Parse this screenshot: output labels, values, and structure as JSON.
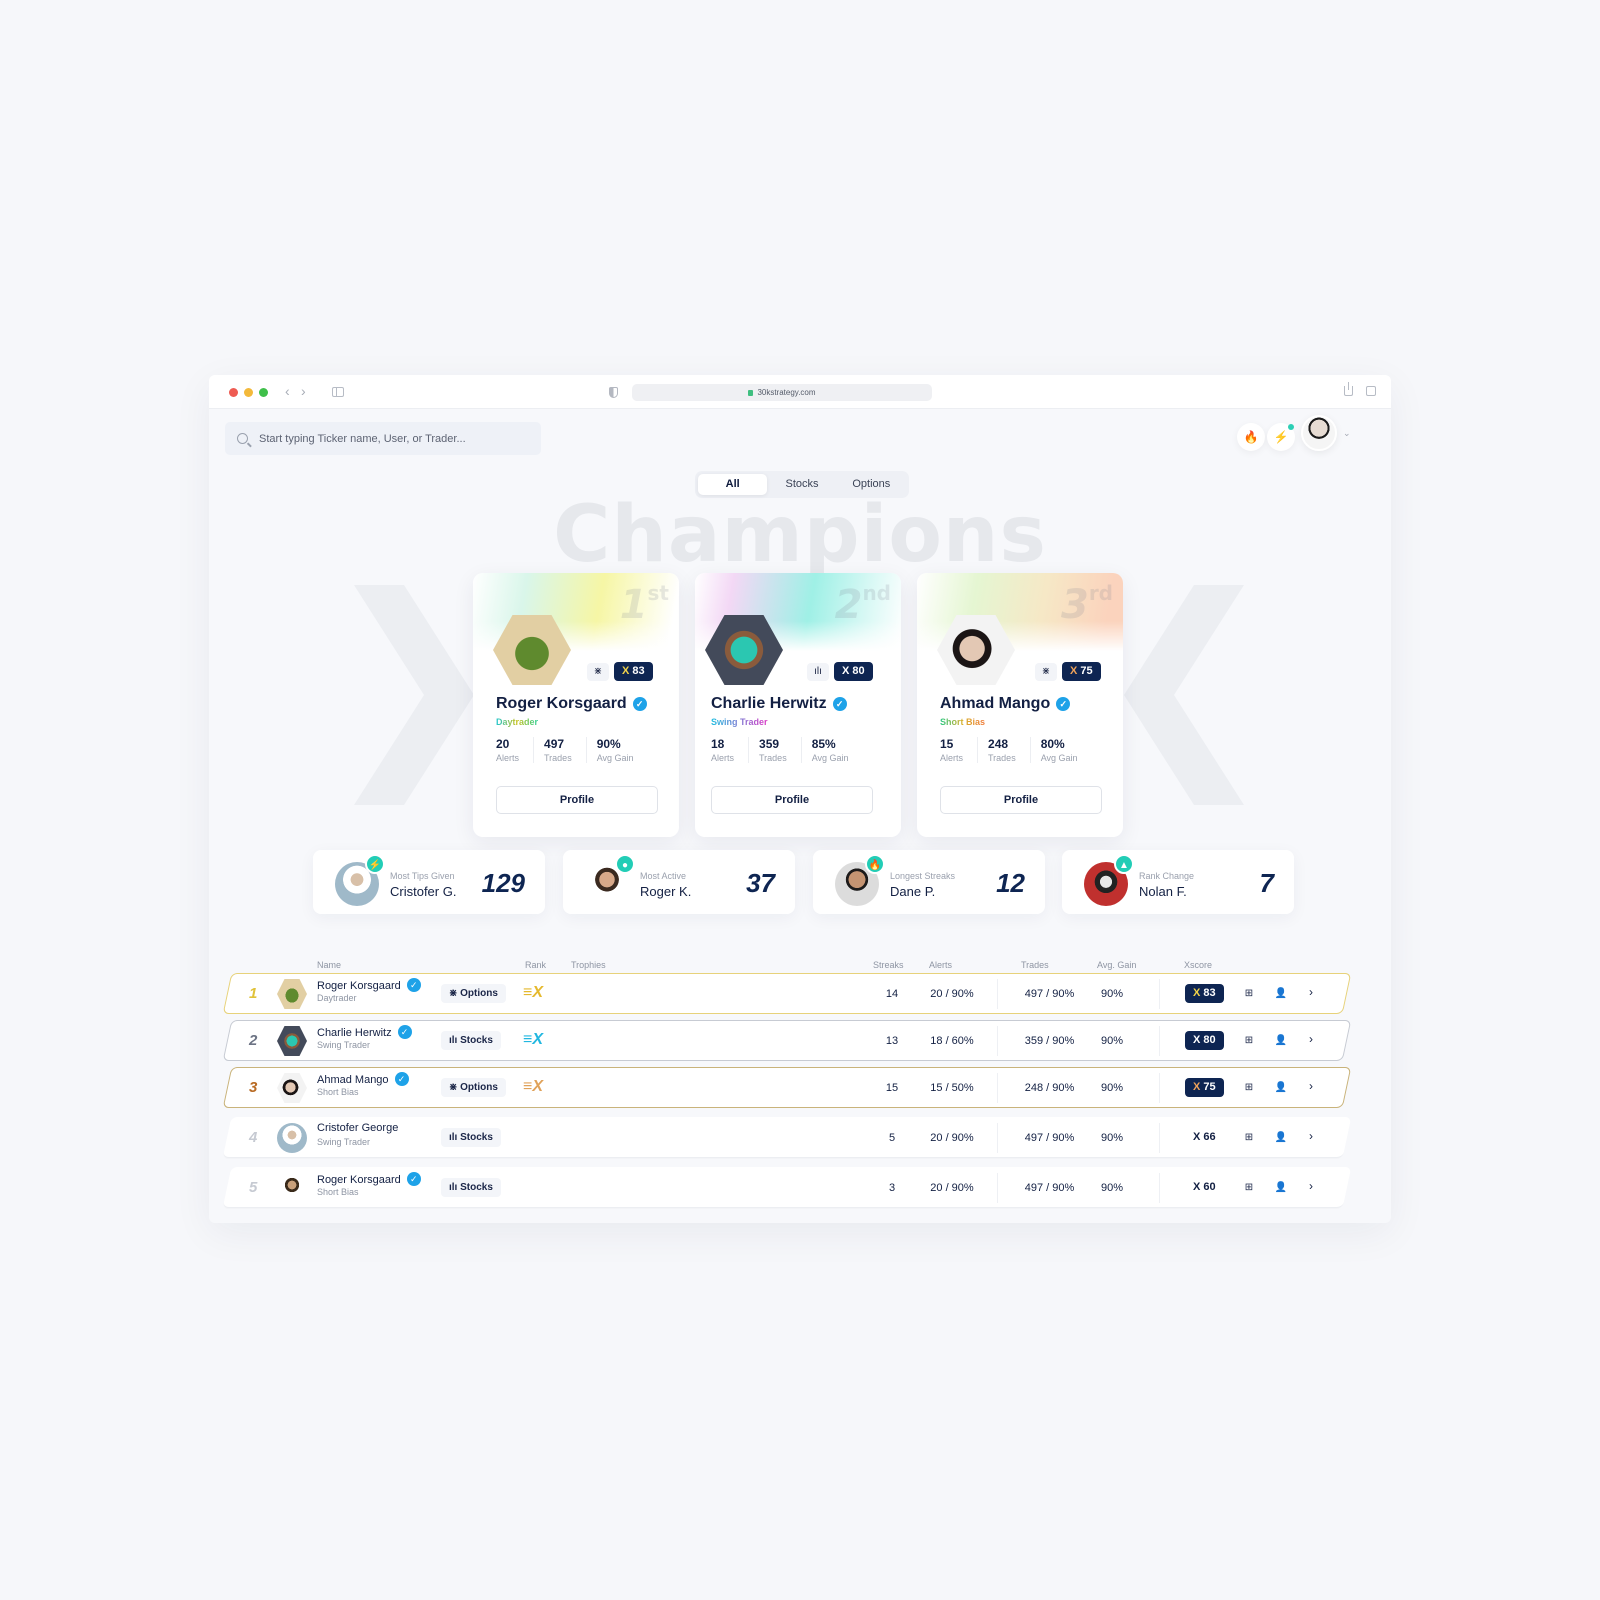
{
  "browser": {
    "url": "30kstrategy.com",
    "back_icon": "chevron-left-icon",
    "forward_icon": "chevron-right-icon"
  },
  "header": {
    "search_placeholder": "Start typing Ticker name, User, or Trader...",
    "fire_icon": "🔥",
    "bolt_icon": "⚡",
    "chevron": "⌄"
  },
  "tabs": [
    {
      "label": "All",
      "active": true
    },
    {
      "label": "Stocks",
      "active": false
    },
    {
      "label": "Options",
      "active": false
    }
  ],
  "hero_title": "Champions",
  "podium": [
    {
      "place": "1",
      "suffix": "st",
      "name": "Roger Korsgaard",
      "type": "Daytrader",
      "market_icon": "⋇",
      "xscore": "83",
      "alerts": "20",
      "trades": "497",
      "avg_gain": "90%",
      "alerts_label": "Alerts",
      "trades_label": "Trades",
      "gain_label": "Avg Gain",
      "button": "Profile",
      "verified": "✓"
    },
    {
      "place": "2",
      "suffix": "nd",
      "name": "Charlie Herwitz",
      "type": "Swing Trader",
      "market_icon": "ılı",
      "xscore": "80",
      "alerts": "18",
      "trades": "359",
      "avg_gain": "85%",
      "alerts_label": "Alerts",
      "trades_label": "Trades",
      "gain_label": "Avg Gain",
      "button": "Profile",
      "verified": "✓"
    },
    {
      "place": "3",
      "suffix": "rd",
      "name": "Ahmad Mango",
      "type": "Short Bias",
      "market_icon": "⋇",
      "xscore": "75",
      "alerts": "15",
      "trades": "248",
      "avg_gain": "80%",
      "alerts_label": "Alerts",
      "trades_label": "Trades",
      "gain_label": "Avg Gain",
      "button": "Profile",
      "verified": "✓"
    }
  ],
  "highlights": [
    {
      "label": "Most Tips Given",
      "name": "Cristofer G.",
      "value": "129",
      "badge": "⚡"
    },
    {
      "label": "Most Active",
      "name": "Roger K.",
      "value": "37",
      "badge": "●"
    },
    {
      "label": "Longest Streaks",
      "name": "Dane P.",
      "value": "12",
      "badge": "🔥"
    },
    {
      "label": "Rank Change",
      "name": "Nolan F.",
      "value": "7",
      "badge": "▲"
    }
  ],
  "table": {
    "columns": {
      "name": "Name",
      "rank": "Rank",
      "trophies": "Trophies",
      "streaks": "Streaks",
      "alerts": "Alerts",
      "trades": "Trades",
      "avg_gain": "Avg. Gain",
      "xscore": "Xscore"
    },
    "rows": [
      {
        "rank": "1",
        "name": "Roger Korsgaard",
        "verified": "✓",
        "type": "Daytrader",
        "market": "⋇ Options",
        "rank_badge": "≡X",
        "streaks": "14",
        "alerts": "20 / 90%",
        "trades": "497 / 90%",
        "avg_gain": "90%",
        "xscore": "83",
        "chevron": "›",
        "action1": "⊞",
        "action2": "👤"
      },
      {
        "rank": "2",
        "name": "Charlie Herwitz",
        "verified": "✓",
        "type": "Swing Trader",
        "market": "ılı Stocks",
        "rank_badge": "≡X",
        "streaks": "13",
        "alerts": "18 / 60%",
        "trades": "359 / 90%",
        "avg_gain": "90%",
        "xscore": "80",
        "chevron": "›",
        "action1": "⊞",
        "action2": "👤"
      },
      {
        "rank": "3",
        "name": "Ahmad Mango",
        "verified": "✓",
        "type": "Short Bias",
        "market": "⋇ Options",
        "rank_badge": "≡X",
        "streaks": "15",
        "alerts": "15 / 50%",
        "trades": "248 / 90%",
        "avg_gain": "90%",
        "xscore": "75",
        "chevron": "›",
        "action1": "⊞",
        "action2": "👤"
      },
      {
        "rank": "4",
        "name": "Cristofer George",
        "verified": "",
        "type": "Swing Trader",
        "market": "ılı Stocks",
        "rank_badge": "",
        "streaks": "5",
        "alerts": "20 / 90%",
        "trades": "497 / 90%",
        "avg_gain": "90%",
        "xscore": "66",
        "chevron": "›",
        "action1": "⊞",
        "action2": "👤"
      },
      {
        "rank": "5",
        "name": "Roger Korsgaard",
        "verified": "✓",
        "type": "Short Bias",
        "market": "ılı Stocks",
        "rank_badge": "",
        "streaks": "3",
        "alerts": "20 / 90%",
        "trades": "497 / 90%",
        "avg_gain": "90%",
        "xscore": "60",
        "chevron": "›",
        "action1": "⊞",
        "action2": "👤"
      }
    ]
  },
  "x_mark": "X",
  "colors": {
    "navy": "#0e2552",
    "teal": "#22cdb6",
    "gold": "#e0c23a",
    "bronze": "#b86b24",
    "verified": "#1ea2e8"
  }
}
